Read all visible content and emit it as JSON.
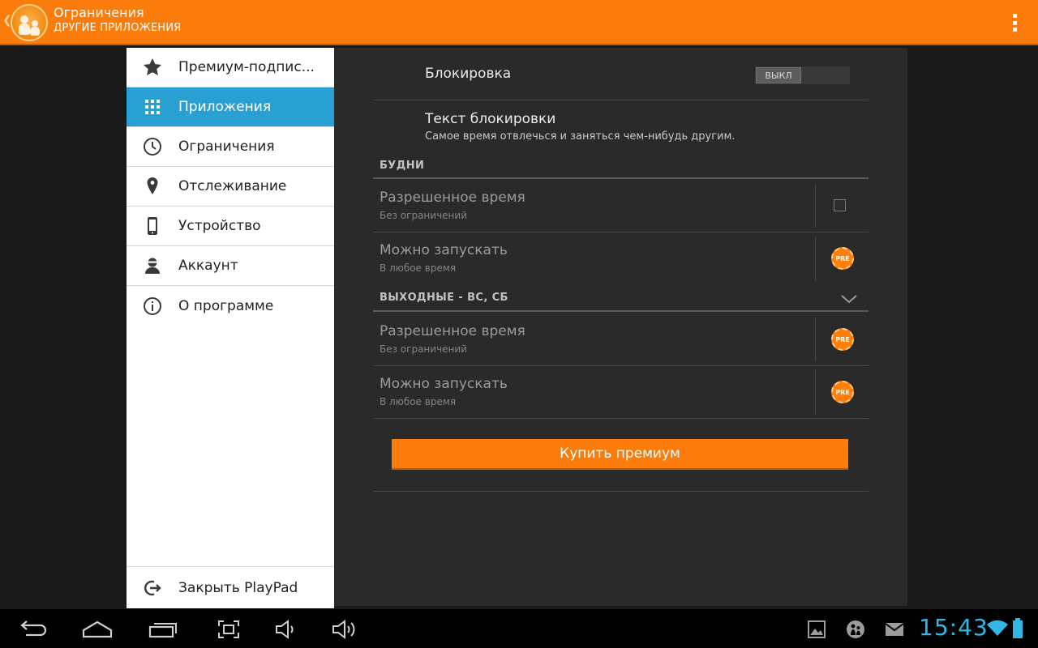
{
  "actionbar": {
    "title": "Ограничения",
    "subtitle": "ДРУГИЕ ПРИЛОЖЕНИЯ",
    "app_icon": "family-icon",
    "overflow_icon": "overflow-menu-icon"
  },
  "sidebar": {
    "items": [
      {
        "label": "Премиум-подпис...",
        "icon": "star-icon"
      },
      {
        "label": "Приложения",
        "icon": "apps-grid-icon",
        "active": true
      },
      {
        "label": "Ограничения",
        "icon": "clock-icon"
      },
      {
        "label": "Отслеживание",
        "icon": "location-pin-icon"
      },
      {
        "label": "Устройство",
        "icon": "phone-icon"
      },
      {
        "label": "Аккаунт",
        "icon": "account-icon"
      },
      {
        "label": "О программе",
        "icon": "info-icon"
      }
    ],
    "close": {
      "label": "Закрыть PlayPad",
      "icon": "exit-icon"
    }
  },
  "content": {
    "lock": {
      "label": "Блокировка",
      "toggle_state": "ВЫКЛ"
    },
    "lock_text": {
      "label": "Текст блокировки",
      "value": "Самое время отвлечься и заняться чем-нибудь другим."
    },
    "weekdays": {
      "header": "БУДНИ",
      "allowed_time": {
        "label": "Разрешенное время",
        "value": "Без ограничений"
      },
      "can_launch": {
        "label": "Можно запускать",
        "value": "В любое время",
        "badge": "PRE"
      }
    },
    "weekend": {
      "header": "ВЫХОДНЫЕ - ВС, СБ",
      "allowed_time": {
        "label": "Разрешенное время",
        "value": "Без ограничений",
        "badge": "PRE"
      },
      "can_launch": {
        "label": "Можно запускать",
        "value": "В любое время",
        "badge": "PRE"
      }
    },
    "buy_button": "Купить премиум"
  },
  "systembar": {
    "clock": "15:43",
    "accent": "#33b5e5"
  },
  "colors": {
    "brand": "#fb7b0b",
    "selected": "#2a9fd1"
  }
}
